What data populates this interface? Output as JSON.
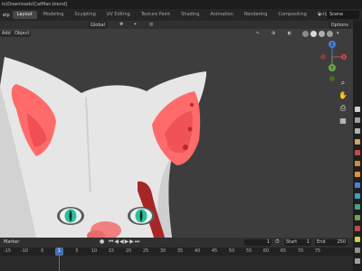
{
  "window": {
    "title": "ts\\Downloads\\CatMan.blend]"
  },
  "workspace_tabs": {
    "menu_stub": "elp",
    "items": [
      {
        "label": "Layout",
        "active": true
      },
      {
        "label": "Modeling",
        "active": false
      },
      {
        "label": "Sculpting",
        "active": false
      },
      {
        "label": "UV Editing",
        "active": false
      },
      {
        "label": "Texture Paint",
        "active": false
      },
      {
        "label": "Shading",
        "active": false
      },
      {
        "label": "Animation",
        "active": false
      },
      {
        "label": "Rendering",
        "active": false
      },
      {
        "label": "Compositing",
        "active": false
      },
      {
        "label": "Scripting",
        "active": false
      }
    ],
    "scene_label": "Scene"
  },
  "viewport_header": {
    "transform_orientation": "Global",
    "options_label": "Options"
  },
  "viewport_header2": {
    "add_label": "Add",
    "object_label": "Object"
  },
  "nav_gizmo": {
    "axes": {
      "x": "X",
      "y": "Y",
      "z": "Z"
    }
  },
  "timeline": {
    "menu_label": "Marker",
    "current_frame": "1",
    "start_label": "Start",
    "start_value": "1",
    "end_label": "End",
    "end_value": "250",
    "ruler_ticks": [
      "-15",
      "-10",
      "-5",
      "0",
      "5",
      "10",
      "15",
      "20",
      "25",
      "30",
      "35",
      "40",
      "45",
      "50",
      "55",
      "60",
      "65",
      "70",
      "75"
    ]
  },
  "colors": {
    "fur": "#e4e4e4",
    "inner_ear": "#ff6d6d",
    "marking": "#a82020",
    "eye_iris": "#2dbf9c",
    "accent_blue": "#4772b3"
  }
}
